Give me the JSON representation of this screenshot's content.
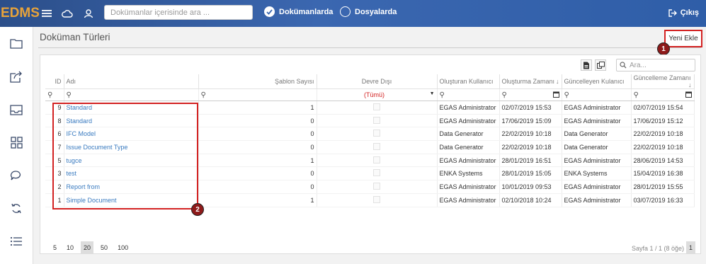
{
  "app": {
    "logo": "EDMS"
  },
  "topbar": {
    "search_placeholder": "Dokümanlar içerisinde ara ...",
    "radio_documents": "Dokümanlarda",
    "radio_folders": "Dosyalarda",
    "logout_label": "Çıkış"
  },
  "page": {
    "title": "Doküman Türleri",
    "add_label": "Yeni Ekle"
  },
  "callouts": {
    "one": "1",
    "two": "2"
  },
  "grid": {
    "search_placeholder": "Ara...",
    "columns": [
      "ID",
      "Adı",
      "Şablon Sayısı",
      "Devre Dışı",
      "Oluşturan Kullanıcı",
      "Oluşturma Zamanı",
      "Güncelleyen Kulanıcı",
      "Güncelleme Zamanı"
    ],
    "filter_all": "(Tümü)",
    "rows": [
      {
        "id": "9",
        "name": "Standard",
        "count": "1",
        "creator": "EGAS Administrator",
        "created": "02/07/2019 15:53",
        "updater": "EGAS Administrator",
        "updated": "02/07/2019 15:54"
      },
      {
        "id": "8",
        "name": "Standard",
        "count": "0",
        "creator": "EGAS Administrator",
        "created": "17/06/2019 15:09",
        "updater": "EGAS Administrator",
        "updated": "17/06/2019 15:12"
      },
      {
        "id": "6",
        "name": "IFC Model",
        "count": "0",
        "creator": "Data Generator",
        "created": "22/02/2019 10:18",
        "updater": "Data Generator",
        "updated": "22/02/2019 10:18"
      },
      {
        "id": "7",
        "name": "Issue Document Type",
        "count": "0",
        "creator": "Data Generator",
        "created": "22/02/2019 10:18",
        "updater": "Data Generator",
        "updated": "22/02/2019 10:18"
      },
      {
        "id": "5",
        "name": "tugce",
        "count": "1",
        "creator": "EGAS Administrator",
        "created": "28/01/2019 16:51",
        "updater": "EGAS Administrator",
        "updated": "28/06/2019 14:53"
      },
      {
        "id": "3",
        "name": "test",
        "count": "0",
        "creator": "ENKA Systems",
        "created": "28/01/2019 15:05",
        "updater": "ENKA Systems",
        "updated": "15/04/2019 16:38"
      },
      {
        "id": "2",
        "name": "Report from",
        "count": "0",
        "creator": "EGAS Administrator",
        "created": "10/01/2019 09:53",
        "updater": "EGAS Administrator",
        "updated": "28/01/2019 15:55"
      },
      {
        "id": "1",
        "name": "Simple Document",
        "count": "1",
        "creator": "EGAS Administrator",
        "created": "02/10/2018 10:24",
        "updater": "EGAS Administrator",
        "updated": "03/07/2019 16:33"
      }
    ]
  },
  "pager": {
    "sizes": [
      "5",
      "10",
      "20",
      "50",
      "100"
    ],
    "selected_size": "20",
    "info": "Sayfa 1 / 1 (8 öğe)",
    "current_page": "1"
  }
}
